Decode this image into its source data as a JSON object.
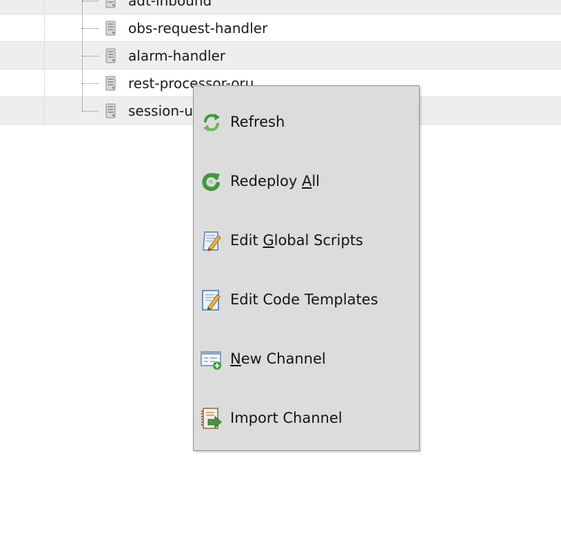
{
  "tree": {
    "nodes": [
      {
        "label": "adt-inbound",
        "icon": "server-channel-icon"
      },
      {
        "label": "obs-request-handler",
        "icon": "server-channel-icon"
      },
      {
        "label": "alarm-handler",
        "icon": "server-channel-icon"
      },
      {
        "label": "rest-processor-oru",
        "icon": "server-channel-icon"
      },
      {
        "label": "session-u",
        "icon": "server-channel-icon"
      }
    ]
  },
  "context_menu": {
    "items": [
      {
        "label": "Refresh",
        "mnemonic": "",
        "icon": "refresh-icon"
      },
      {
        "label": "Redeploy All",
        "mnemonic": "A",
        "icon": "redeploy-icon"
      },
      {
        "label": "Edit Global Scripts",
        "mnemonic": "G",
        "icon": "edit-scripts-icon"
      },
      {
        "label": "Edit Code Templates",
        "mnemonic": "",
        "icon": "edit-templates-icon"
      },
      {
        "label": "New Channel",
        "mnemonic": "N",
        "icon": "new-channel-icon"
      },
      {
        "label": "Import Channel",
        "mnemonic": "",
        "icon": "import-channel-icon"
      }
    ]
  },
  "colors": {
    "menu_bg": "#dcdcdc",
    "row_alt": "#eeeeee",
    "icon_green": "#3f9a3a"
  }
}
